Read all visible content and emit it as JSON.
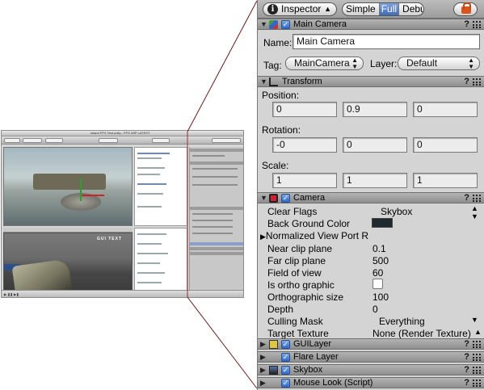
{
  "thumbnail": {
    "title": "Island FPS Test.unity - FPS WIP LATEST",
    "game_text": "GUI TEXT"
  },
  "inspector": {
    "dropdown_label": "Inspector",
    "mode_options": [
      "Simple",
      "Full",
      "Debug"
    ],
    "mode_selected": "Full",
    "main_camera": {
      "header": "Main Camera",
      "name_label": "Name:",
      "name_value": "Main Camera",
      "tag_label": "Tag:",
      "tag_value": "MainCamera",
      "layer_label": "Layer:",
      "layer_value": "Default"
    },
    "transform": {
      "header": "Transform",
      "position_label": "Position:",
      "position": [
        "0",
        "0.9",
        "0"
      ],
      "rotation_label": "Rotation:",
      "rotation": [
        "-0",
        "0",
        "0"
      ],
      "scale_label": "Scale:",
      "scale": [
        "1",
        "1",
        "1"
      ]
    },
    "camera": {
      "header": "Camera",
      "props": [
        {
          "label": "Clear Flags",
          "value": "Skybox"
        },
        {
          "label": "Back Ground Color",
          "value": ""
        },
        {
          "label": "Normalized View Port R",
          "value": ""
        },
        {
          "label": "Near clip plane",
          "value": "0.1"
        },
        {
          "label": "Far clip plane",
          "value": "500"
        },
        {
          "label": "Field of view",
          "value": "60"
        },
        {
          "label": "Is ortho graphic",
          "value": ""
        },
        {
          "label": "Orthographic size",
          "value": "100"
        },
        {
          "label": "Depth",
          "value": "0"
        },
        {
          "label": "Culling Mask",
          "value": "Everything"
        },
        {
          "label": "Target Texture",
          "value": "None (Render Texture)"
        }
      ],
      "background_color": "#1e2a2e"
    },
    "components": [
      {
        "name": "GUILayer"
      },
      {
        "name": "Flare Layer"
      },
      {
        "name": "Skybox"
      },
      {
        "name": "Mouse Look (Script)"
      }
    ],
    "help_glyph": "?"
  }
}
